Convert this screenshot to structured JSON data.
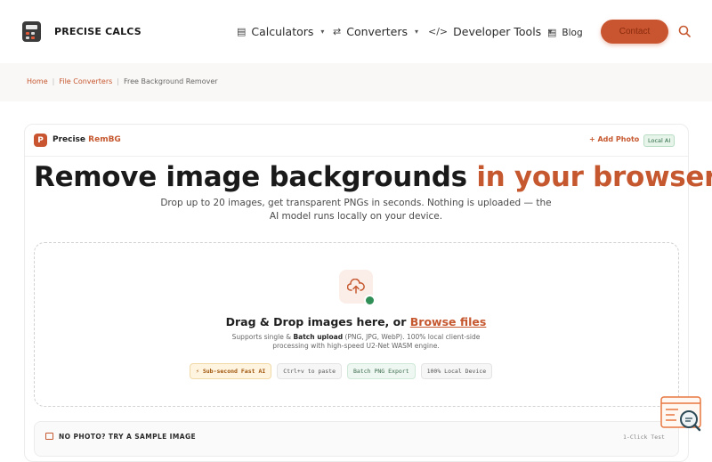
{
  "brand": {
    "name": "PRECISE CALCS"
  },
  "nav": {
    "items": [
      {
        "label": "Calculators",
        "icon": "calculator-icon"
      },
      {
        "label": "Converters",
        "icon": "arrows-swap-icon"
      },
      {
        "label": "Developer Tools",
        "icon": "code-icon"
      },
      {
        "label": "Blog",
        "icon": "document-icon"
      }
    ],
    "contact_label": "Contact"
  },
  "breadcrumb": [
    {
      "label": "Home"
    },
    {
      "label": "File Converters"
    },
    {
      "label": "Free Background Remover"
    }
  ],
  "app": {
    "badge": "P",
    "name_prefix": "Precise ",
    "name_accent": "RemBG",
    "add_photo": "+ Add Photo",
    "local_badge": "Local AI"
  },
  "hero": {
    "title_main": "Remove image backgrounds ",
    "title_accent": "in your browser",
    "subtitle": "Drop up to 20 images, get transparent PNGs in seconds. Nothing is uploaded — the AI model runs locally on your device."
  },
  "dropzone": {
    "title": "Drag & Drop images here, or ",
    "browse": "Browse files",
    "desc_pre": "Supports single & ",
    "desc_bold": "Batch upload",
    "desc_post": " (PNG, JPG, WebP). 100% local client-side processing with high-speed U2-Net WASM engine.",
    "chips": [
      "⚡ Sub-second Fast AI",
      "Ctrl+v to paste",
      "Batch PNG Export",
      "100% Local Device"
    ]
  },
  "sample": {
    "title": "NO PHOTO? TRY A SAMPLE IMAGE",
    "hint": "1-Click Test"
  },
  "colors": {
    "accent": "#c65830",
    "button": "#c8552f",
    "success": "#2f8f56"
  }
}
